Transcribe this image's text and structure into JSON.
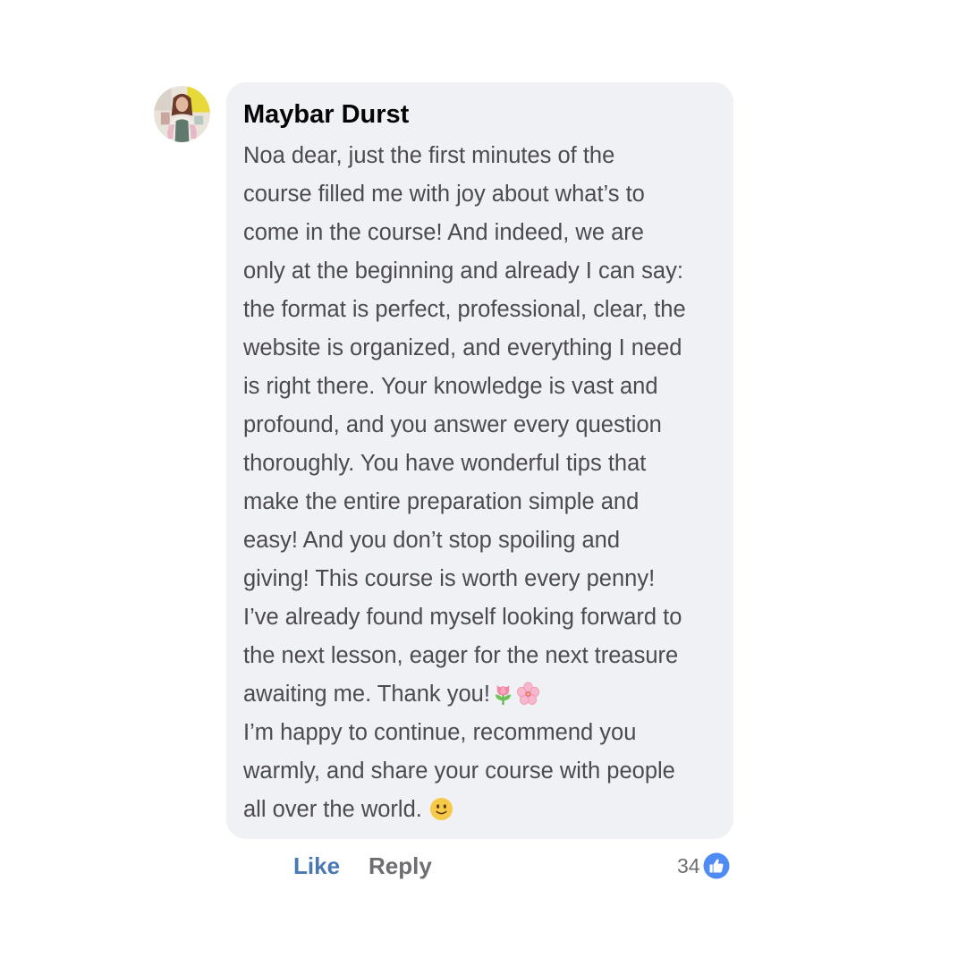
{
  "comment": {
    "author": "Maybar Durst",
    "lines": [
      "Noa dear, just the first minutes of the",
      "course filled me with joy about what’s to",
      "come in the course! And indeed, we are",
      "only at the beginning and already I can say:",
      "the format is perfect, professional, clear, the",
      "website is organized, and everything I need",
      "is right there. Your knowledge is vast and",
      "profound, and you answer every question",
      "thoroughly. You have wonderful tips that",
      "make the entire preparation simple and",
      "easy! And you don’t stop spoiling and",
      "giving! This course is worth every penny!",
      "I’ve already found myself looking forward to",
      "the next lesson, eager for the next treasure",
      "awaiting me. Thank you!",
      "I’m happy to continue, recommend you",
      "warmly, and share your course with people",
      "all over the world."
    ],
    "emoji": {
      "thank_you_line": [
        "tulip-emoji",
        "cherry-blossom-emoji"
      ],
      "last_line": "slightly-smiling-face-emoji"
    }
  },
  "actions": {
    "like_label": "Like",
    "reply_label": "Reply"
  },
  "reactions": {
    "count": "34",
    "icon": "thumbs-up-icon",
    "badge_color": "#4f8bf5"
  },
  "colors": {
    "bubble_bg": "#f0f1f5",
    "author_text": "#050505",
    "body_text": "#4b4b4f",
    "like_link": "#4a78b5",
    "reply_link": "#6e6e73"
  }
}
